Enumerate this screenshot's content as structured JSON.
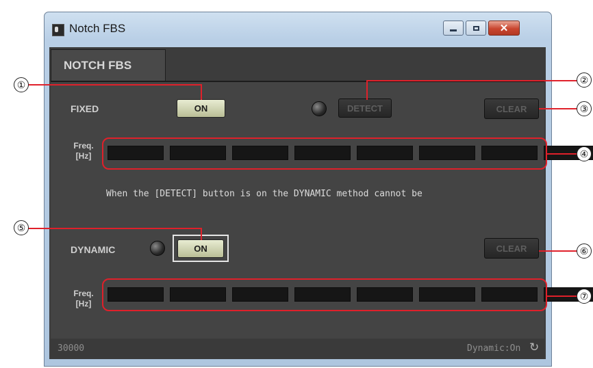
{
  "window": {
    "title": "Notch FBS"
  },
  "tab": {
    "label": "NOTCH FBS"
  },
  "fixed": {
    "label": "FIXED",
    "on_label": "ON",
    "detect_label": "DETECT",
    "clear_label": "CLEAR",
    "freq_label_1": "Freq.",
    "freq_label_2": "[Hz]",
    "freq_values": [
      "",
      "",
      "",
      "",
      "",
      "",
      "",
      ""
    ]
  },
  "note": "When the [DETECT] button is on the DYNAMIC method cannot be",
  "dynamic": {
    "label": "DYNAMIC",
    "on_label": "ON",
    "clear_label": "CLEAR",
    "freq_label_1": "Freq.",
    "freq_label_2": "[Hz]",
    "freq_values": [
      "",
      "",
      "",
      "",
      "",
      "",
      "",
      ""
    ]
  },
  "status": {
    "left": "30000",
    "right": "Dynamic:On"
  },
  "callouts": [
    "①",
    "②",
    "③",
    "④",
    "⑤",
    "⑥",
    "⑦"
  ],
  "colors": {
    "highlight": "#e0202a",
    "on_button": "#c9cda8",
    "panel": "#444444"
  },
  "icons": [
    "app-icon",
    "minimize-icon",
    "maximize-icon",
    "close-icon",
    "refresh-icon",
    "led-indicator"
  ]
}
